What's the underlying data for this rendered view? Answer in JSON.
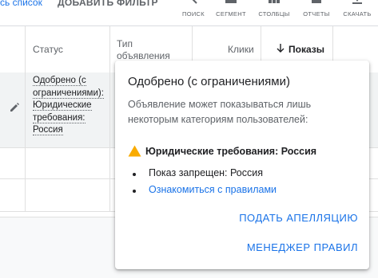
{
  "toolbar": {
    "list_link": "сь список",
    "add_filter": "ДОБАВИТЬ ФИЛЬТР",
    "tools": [
      {
        "label": "ПОИСК",
        "icon": "search-icon"
      },
      {
        "label": "СЕГМЕНТ",
        "icon": "segment-icon"
      },
      {
        "label": "СТОЛБЦЫ",
        "icon": "columns-icon"
      },
      {
        "label": "ОТЧЕТЫ",
        "icon": "reports-icon"
      },
      {
        "label": "СКАЧАТЬ",
        "icon": "download-icon"
      }
    ]
  },
  "table": {
    "headers": {
      "status": "Статус",
      "ad_type_line1": "Тип",
      "ad_type_line2": "объявления",
      "clicks": "Клики",
      "impressions": "Показы"
    },
    "row1_status_lines": [
      "Одобрено (с",
      "ограничениями):",
      "Юридические",
      "требования:",
      "Россия"
    ]
  },
  "popup": {
    "title": "Одобрено (с ограничениями)",
    "description": "Объявление может показываться лишь некоторым категориям пользователей:",
    "warning": "Юридические требования: Россия",
    "bullet_text": "Показ запрещен: Россия",
    "bullet_link": "Ознакомиться с правилами",
    "appeal_button": "ПОДАТЬ АПЕЛЛЯЦИЮ",
    "manager_button": "МЕНЕДЖЕР ПРАВИЛ"
  },
  "colors": {
    "accent": "#1a73e8",
    "warning": "#f9ab00",
    "selected_row": "#f1f3f4"
  }
}
